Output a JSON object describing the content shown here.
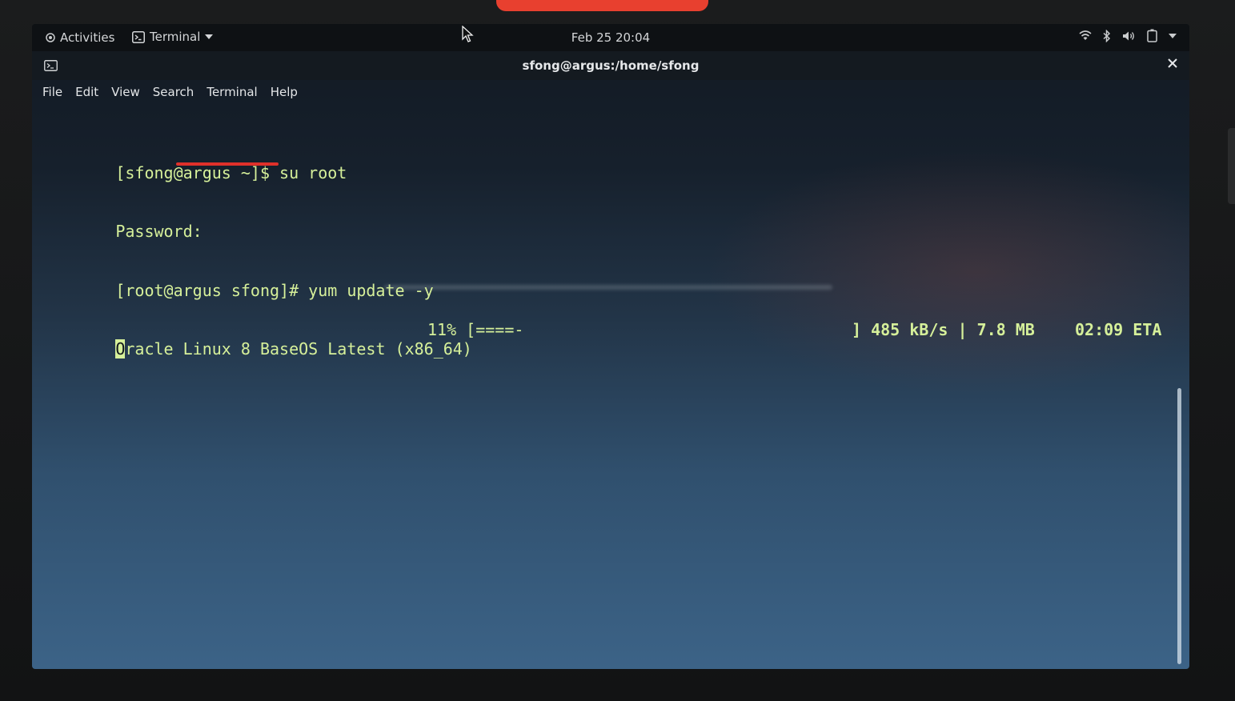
{
  "topbar": {
    "activities_label": "Activities",
    "app_menu_label": "Terminal",
    "clock": "Feb 25  20:04",
    "tray_icons": [
      "wifi-icon",
      "bluetooth-icon",
      "volume-icon",
      "battery-icon",
      "chevron-down-icon"
    ]
  },
  "window": {
    "title": "sfong@argus:/home/sfong",
    "menu": [
      "File",
      "Edit",
      "View",
      "Search",
      "Terminal",
      "Help"
    ]
  },
  "terminal": {
    "lines": [
      "[sfong@argus ~]$ su root",
      "Password:",
      "[root@argus sfong]# yum update -y"
    ],
    "progress": {
      "cursor_char": "O",
      "repo": "racle Linux 8 BaseOS Latest (x86_64)",
      "bar": "11% [====-",
      "speed_size": "] 485 kB/s | 7.8 MB",
      "eta": "02:09 ETA",
      "percent": 11
    }
  },
  "colors": {
    "terminal_text": "#d6f09a",
    "annotation_underline": "#e0302a",
    "background_top": "#121922",
    "background_bottom": "#3c6387"
  }
}
